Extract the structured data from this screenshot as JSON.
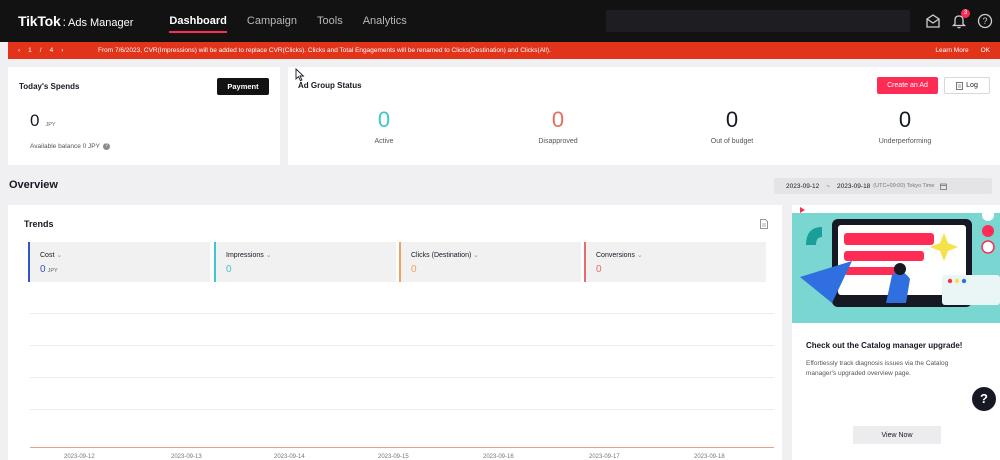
{
  "header": {
    "brand": "TikTok",
    "separator": ":",
    "product": "Ads Manager",
    "nav": [
      {
        "label": "Dashboard",
        "active": true
      },
      {
        "label": "Campaign",
        "active": false
      },
      {
        "label": "Tools",
        "active": false
      },
      {
        "label": "Analytics",
        "active": false
      }
    ],
    "notification_count": "3"
  },
  "notice": {
    "prev_icon": "chevron-left-icon",
    "current_page": "1",
    "page_sep": "/",
    "total_pages": "4",
    "next_icon": "chevron-right-icon",
    "message": "From 7/6/2023, CVR(Impressions) will be added to replace CVR(Clicks). Clicks and Total Engagements will be renamed to Clicks(Destination) and Clicks(All).",
    "learn_more": "Learn More",
    "ok": "OK"
  },
  "spends": {
    "title": "Today's Spends",
    "payment_button": "Payment",
    "amount": "0",
    "currency": "JPY",
    "available_balance": "Available balance 0 JPY"
  },
  "ad_group_status": {
    "title": "Ad Group Status",
    "create_button": "Create an Ad",
    "log_button": "Log",
    "columns": [
      {
        "value": "0",
        "label": "Active",
        "color": "#3fc5cf"
      },
      {
        "value": "0",
        "label": "Disapproved",
        "color": "#e56c5e"
      },
      {
        "value": "0",
        "label": "Out of budget",
        "color": "#161823"
      },
      {
        "value": "0",
        "label": "Underperforming",
        "color": "#161823"
      }
    ]
  },
  "overview": {
    "title": "Overview",
    "date_start": "2023-09-12",
    "date_sep": "~",
    "date_end": "2023-09-18",
    "timezone": "(UTC+09:00) Tokyo Time"
  },
  "trends": {
    "title": "Trends",
    "metrics": [
      {
        "name": "Cost",
        "value": "0",
        "unit": "JPY",
        "color": "#3355cc"
      },
      {
        "name": "Impressions",
        "value": "0",
        "unit": "",
        "color": "#3fc5cf"
      },
      {
        "name": "Clicks (Destination)",
        "value": "0",
        "unit": "",
        "color": "#f0a25c"
      },
      {
        "name": "Conversions",
        "value": "0",
        "unit": "",
        "color": "#e56c6c"
      }
    ],
    "x_dates": [
      "2023-09-12",
      "2023-09-13",
      "2023-09-14",
      "2023-09-15",
      "2023-09-16",
      "2023-09-17",
      "2023-09-18"
    ]
  },
  "promo": {
    "title": "Check out the Catalog manager upgrade!",
    "description": "Effortlessly track diagnosis issues via the Catalog manager's upgraded overview page.",
    "button": "View Now"
  },
  "help_label": "?"
}
